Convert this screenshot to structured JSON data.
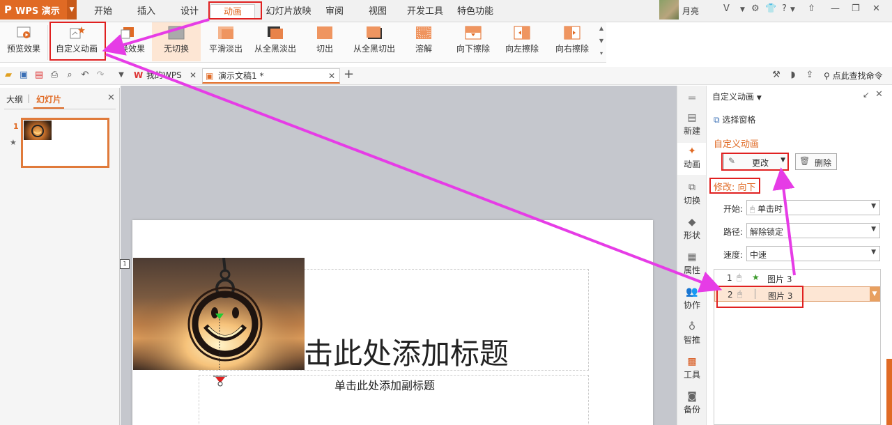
{
  "app": {
    "name": "WPS 演示",
    "logo": "P"
  },
  "menu": {
    "tabs": [
      "开始",
      "插入",
      "设计",
      "动画",
      "幻灯片放映",
      "审阅",
      "视图",
      "开发工具",
      "特色功能"
    ],
    "active": "动画"
  },
  "user": {
    "name": "月亮"
  },
  "ribbon": {
    "preview": "预览效果",
    "custom_anim": "自定义动画",
    "switch_effect": "切换效果",
    "transitions": [
      "无切换",
      "平滑淡出",
      "从全黑淡出",
      "切出",
      "从全黑切出",
      "溶解",
      "向下擦除",
      "向左擦除",
      "向右擦除"
    ]
  },
  "tabs": {
    "mywps": "我的WPS",
    "doc": "演示文稿1 *",
    "search_cmd": "点此查找命令"
  },
  "left_pane": {
    "outline": "大纲",
    "slides": "幻灯片",
    "slide_number": "1"
  },
  "slide": {
    "title": "击此处添加标题",
    "subtitle": "单击此处添加副标题",
    "anchor_tag": "1"
  },
  "sidebar": {
    "items": [
      "新建",
      "动画",
      "切换",
      "形状",
      "属性",
      "协作",
      "智推",
      "工具",
      "备份"
    ]
  },
  "task_pane": {
    "header": "自定义动画",
    "select_pane": "选择窗格",
    "section": "自定义动画",
    "change_btn": "更改",
    "delete_btn": "删除",
    "modify_label": "修改: 向下",
    "start_label": "开始:",
    "start_value": "单击时",
    "path_label": "路径:",
    "path_value": "解除锁定",
    "speed_label": "速度:",
    "speed_value": "中速",
    "list": [
      {
        "num": "1",
        "name": "图片 3"
      },
      {
        "num": "2",
        "name": "图片 3"
      }
    ]
  },
  "colors": {
    "accent": "#e06a24",
    "annotation_red": "#e02020",
    "annotation_magenta": "#e63ce6"
  }
}
